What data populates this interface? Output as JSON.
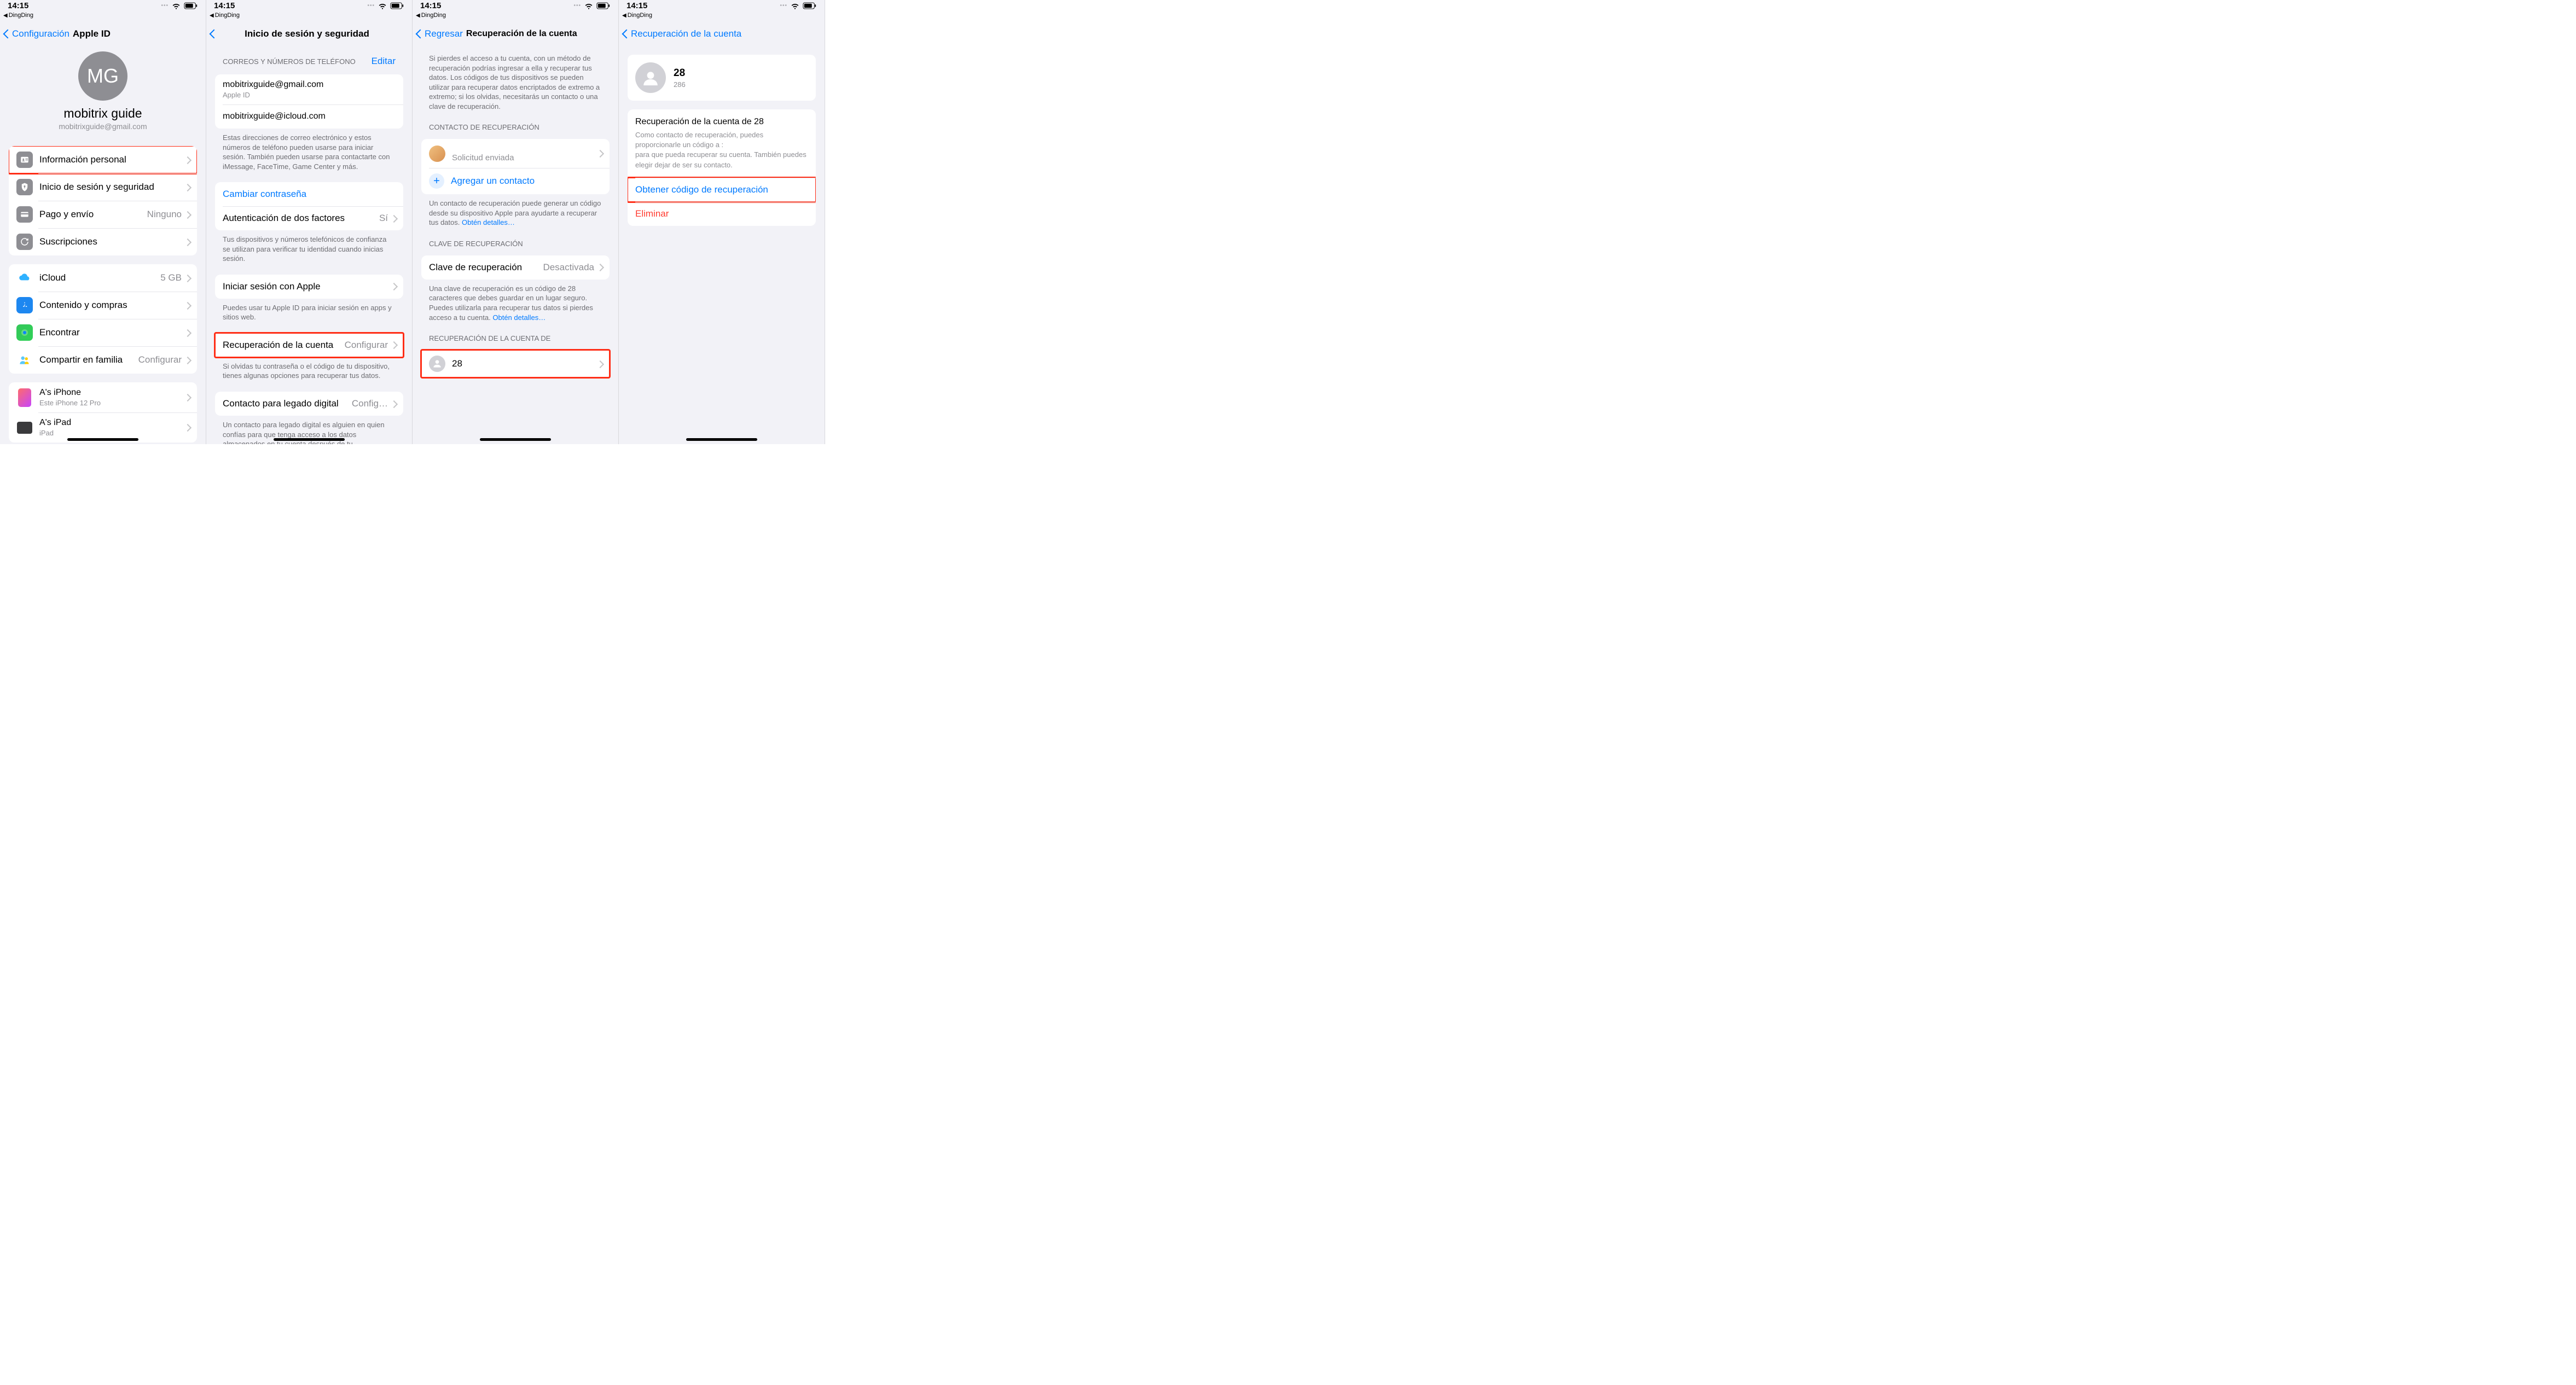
{
  "status": {
    "time": "14:15",
    "breadcrumb": "DingDing"
  },
  "screen1": {
    "nav_back": "Configuración",
    "nav_title": "Apple ID",
    "avatar_initials": "MG",
    "profile_name": "mobitrix guide",
    "profile_email": "mobitrixguide@gmail.com",
    "rows": {
      "personal": "Información personal",
      "signin": "Inicio de sesión y seguridad",
      "payment": "Pago y envío",
      "payment_detail": "Ninguno",
      "subs": "Suscripciones",
      "icloud": "iCloud",
      "icloud_detail": "5 GB",
      "content": "Contenido y compras",
      "find": "Encontrar",
      "family": "Compartir en familia",
      "family_detail": "Configurar",
      "dev1_name": "A's iPhone",
      "dev1_sub": "Este iPhone 12 Pro",
      "dev2_name": "A's iPad",
      "dev2_sub": "iPad"
    }
  },
  "screen2": {
    "nav_title": "Inicio de sesión y seguridad",
    "header_emails": "CORREOS Y NÚMEROS DE TELÉFONO",
    "edit": "Editar",
    "email1": "mobitrixguide@gmail.com",
    "email1_sub": "Apple ID",
    "email2": "mobitrixguide@icloud.com",
    "footer_emails": "Estas direcciones de correo electrónico y estos números de teléfono pueden usarse para iniciar sesión. También pueden usarse para contactarte con iMessage, FaceTime, Game Center y más.",
    "change_pw": "Cambiar contraseña",
    "two_factor": "Autenticación de dos factores",
    "two_factor_detail": "Sí",
    "footer_2fa": "Tus dispositivos y números telefónicos de confianza se utilizan para verificar tu identidad cuando inicias sesión.",
    "signin_apple": "Iniciar sesión con Apple",
    "footer_signin": "Puedes usar tu Apple ID para iniciar sesión en apps y sitios web.",
    "recovery": "Recuperación de la cuenta",
    "recovery_detail": "Configurar",
    "footer_recovery": "Si olvidas tu contraseña o el código de tu dispositivo, tienes algunas opciones para recuperar tus datos.",
    "legacy": "Contacto para legado digital",
    "legacy_detail": "Config…",
    "footer_legacy": "Un contacto para legado digital es alguien en quien confías para que tenga acceso a los datos almacenados en tu cuenta después de tu"
  },
  "screen3": {
    "nav_back": "Regresar",
    "nav_title": "Recuperación de la cuenta",
    "intro": "Si pierdes el acceso a tu cuenta, con un método de recuperación podrías ingresar a ella y recuperar tus datos. Los códigos de tus dispositivos se pueden utilizar para recuperar datos encriptados de extremo a extremo; si los olvidas, necesitarás un contacto o una clave de recuperación.",
    "header_contact": "CONTACTO DE RECUPERACIÓN",
    "contact_sub": "Solicitud enviada",
    "add_contact": "Agregar un contacto",
    "footer_contact": "Un contacto de recuperación puede generar un código desde su dispositivo Apple para ayudarte a recuperar tus datos. ",
    "details_link": "Obtén detalles…",
    "header_key": "CLAVE DE RECUPERACIÓN",
    "key_label": "Clave de recuperación",
    "key_detail": "Desactivada",
    "footer_key": "Una clave de recuperación es un código de 28 caracteres que debes guardar en un lugar seguro. Puedes utilizarla para recuperar tus datos si pierdes acceso a tu cuenta. ",
    "header_for": "RECUPERACIÓN DE LA CUENTA DE",
    "for_name": "28"
  },
  "screen4": {
    "nav_back": "Recuperación de la cuenta",
    "name": "28",
    "sub": "286",
    "recovery_title": "Recuperación de la cuenta de 28",
    "desc1": "Como contacto de recuperación, puedes proporcionarle un código a :",
    "desc2": "para que pueda recuperar su cuenta. También puedes elegir dejar de ser su contacto.",
    "get_code": "Obtener código de recuperación",
    "remove": "Eliminar"
  }
}
